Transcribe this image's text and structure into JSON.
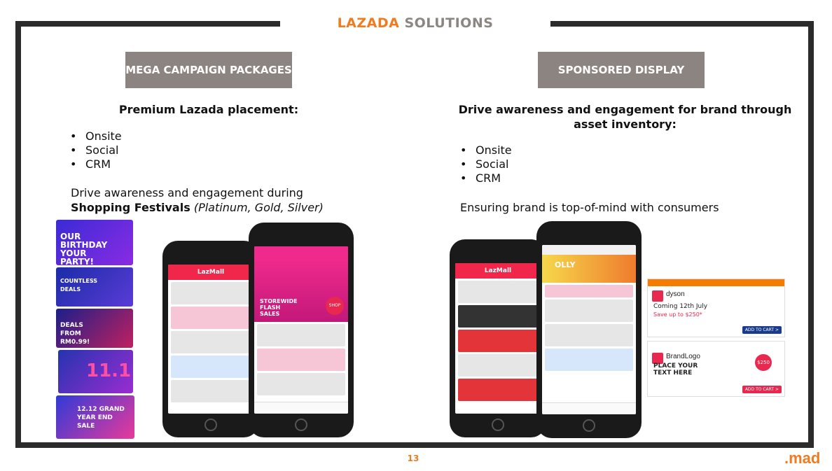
{
  "header": {
    "brand": "LAZADA",
    "title_rest": " SOLUTIONS"
  },
  "left": {
    "heading": "MEGA CAMPAIGN PACKAGES",
    "lead": "Premium Lazada placement:",
    "bullets": [
      "Onsite",
      "Social",
      "CRM"
    ],
    "desc_line1": "Drive awareness and engagement during",
    "desc_bold": "Shopping Festivals",
    "desc_italic": "(Platinum, Gold, Silver)",
    "banners": [
      "OUR BIRTHDAY YOUR PARTY!",
      "COUNTLESS DEALS",
      "DEALS FROM RM0.99!",
      "11.11",
      "12.12 GRAND YEAR END SALE"
    ],
    "phone_a_title": "LazMall",
    "phone_b_title": "STOREWIDE FLASH SALES"
  },
  "right": {
    "heading": "SPONSORED DISPLAY",
    "lead": "Drive awareness and engagement for brand through asset inventory:",
    "bullets": [
      "Onsite",
      "Social",
      "CRM"
    ],
    "desc": "Ensuring brand is top-of-mind with consumers",
    "phone_a_title": "LazMall",
    "phone_b_title": "OLLY",
    "ads": [
      {
        "brand": "dyson",
        "line1": "Coming 12th July",
        "line2": "Save up to $250*",
        "cta": "ADD TO CART >"
      },
      {
        "brand": "BrandLogo",
        "line1": "PLACE YOUR TEXT HERE",
        "price": "$250",
        "cta": "ADD TO CART >"
      }
    ]
  },
  "footer": {
    "page_number": "13",
    "logo": ".mad"
  },
  "colors": {
    "accent": "#f07c22",
    "heading_bg": "#8c8480",
    "frame": "#2b2b2b",
    "lazada_red": "#f0264b"
  }
}
